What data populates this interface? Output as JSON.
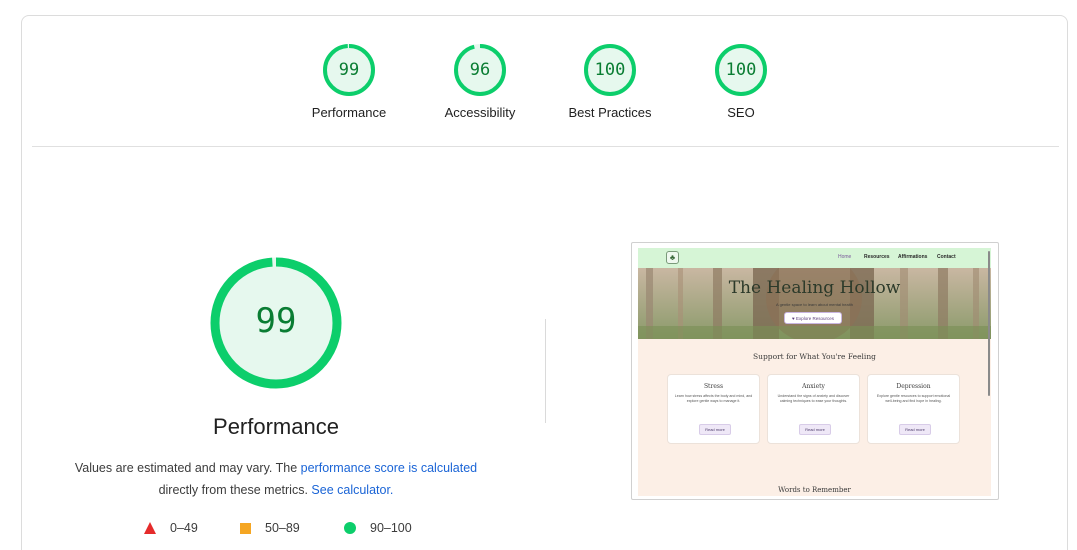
{
  "categories": [
    {
      "label": "Performance",
      "score": "99",
      "value": 99
    },
    {
      "label": "Accessibility",
      "score": "96",
      "value": 96
    },
    {
      "label": "Best Practices",
      "score": "100",
      "value": 100
    },
    {
      "label": "SEO",
      "score": "100",
      "value": 100
    }
  ],
  "main": {
    "score": "99",
    "value": 99,
    "title": "Performance",
    "desc_prefix": "Values are estimated and may vary. The ",
    "desc_link1": "performance score is calculated",
    "desc_middle": "directly from these metrics. ",
    "desc_link2": "See calculator."
  },
  "legend": [
    {
      "icon": "triangle-icon",
      "range": "0–49",
      "color": "#e52b2b"
    },
    {
      "icon": "square-icon",
      "range": "50–89",
      "color": "#f5a623"
    },
    {
      "icon": "circle-icon",
      "range": "90–100",
      "color": "#0cce6b"
    }
  ],
  "colors": {
    "pass": "#0cce6b",
    "pass_fill": "#e6f8ee",
    "pass_text": "#0a7d33"
  },
  "thumbnail": {
    "nav": [
      "Home",
      "Resources",
      "Affirmations",
      "Contact"
    ],
    "hero_title": "The Healing Hollow",
    "hero_subtitle": "A gentle space to learn about mental health",
    "hero_button": "♥ Explore Resources",
    "section_title": "Support for What You're Feeling",
    "cards": [
      {
        "title": "Stress",
        "body": "Learn how stress affects the body and mind, and explore gentle ways to manage it.",
        "button": "Read more"
      },
      {
        "title": "Anxiety",
        "body": "Understand the signs of anxiety and discover calming techniques to ease your thoughts.",
        "button": "Read more"
      },
      {
        "title": "Depression",
        "body": "Explore gentle resources to support emotional well-being and find hope in healing.",
        "button": "Read more"
      }
    ],
    "footer_title": "Words to Remember"
  }
}
